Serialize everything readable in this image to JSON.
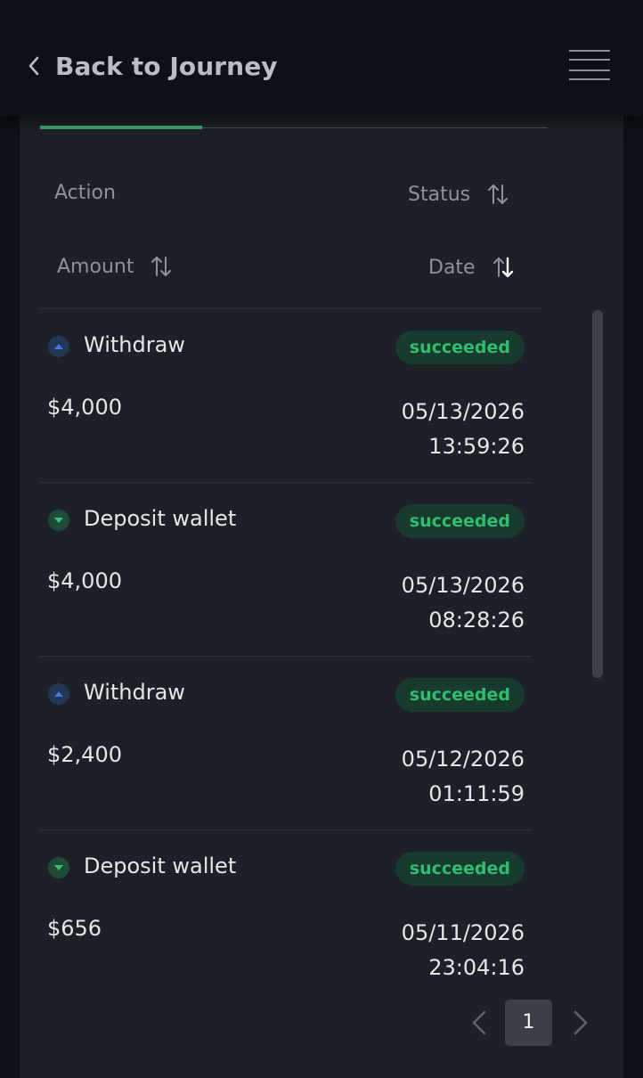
{
  "header": {
    "back_label": "Back to Journey",
    "back_icon": "chevron-left-icon",
    "menu_icon": "hamburger-menu-icon"
  },
  "columns": {
    "action": "Action",
    "status": "Status",
    "amount": "Amount",
    "date": "Date"
  },
  "transactions": [
    {
      "direction": "up",
      "action": "Withdraw",
      "status": "succeeded",
      "amount": "$4,000",
      "date": "05/13/2026",
      "time": "13:59:26"
    },
    {
      "direction": "down",
      "action": "Deposit wallet",
      "status": "succeeded",
      "amount": "$4,000",
      "date": "05/13/2026",
      "time": "08:28:26"
    },
    {
      "direction": "up",
      "action": "Withdraw",
      "status": "succeeded",
      "amount": "$2,400",
      "date": "05/12/2026",
      "time": "01:11:59"
    },
    {
      "direction": "down",
      "action": "Deposit wallet",
      "status": "succeeded",
      "amount": "$656",
      "date": "05/11/2026",
      "time": "23:04:16"
    }
  ],
  "pagination": {
    "current_page": "1"
  },
  "colors": {
    "accent_green": "#3aa66f",
    "badge_text": "#2fbe70",
    "badge_bg": "#193a2e",
    "withdraw_icon_bg": "#243656",
    "deposit_icon_bg": "#1f4a37"
  }
}
